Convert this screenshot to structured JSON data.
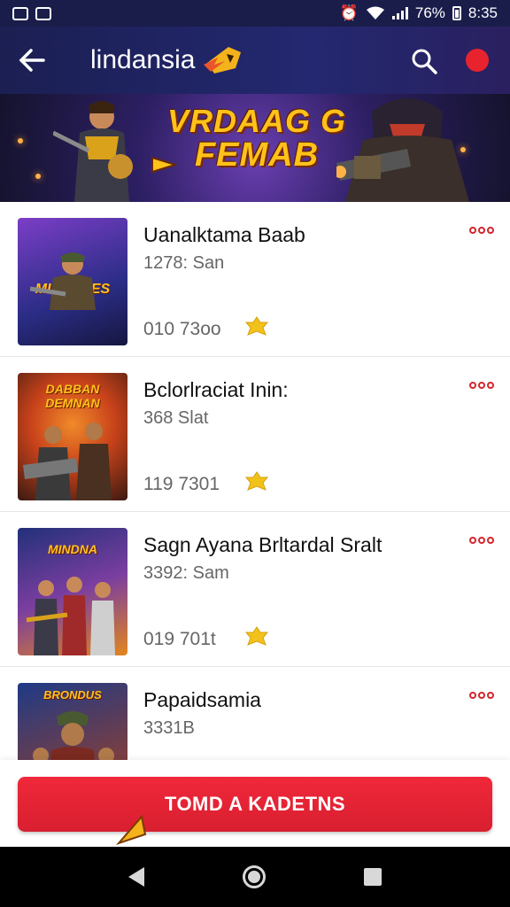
{
  "status_bar": {
    "battery": "76%",
    "time": "8:35",
    "icons": [
      "gallery-icon",
      "notification-icon",
      "alarm-icon",
      "wifi-icon",
      "signal-icon",
      "battery-icon"
    ]
  },
  "app_bar": {
    "title": "lindansia",
    "back_icon": "arrow-left-icon",
    "search_icon": "search-icon",
    "record_icon": "red-dot-icon"
  },
  "banner": {
    "line1": "VRDAAG G",
    "line2": "FEMAB"
  },
  "list": {
    "items": [
      {
        "thumb_title": "MIDNSCES GIAD",
        "title": "Uanalktama Baab",
        "subtitle": "1278: San",
        "count": "010 73oo",
        "colors": [
          "#2b2d86",
          "#7b3ec7"
        ]
      },
      {
        "thumb_title": "DABBAN DEMNAN",
        "title": "Bclorlraciat Inin:",
        "subtitle": "368 Slat",
        "count": "119 7301",
        "colors": [
          "#c8421a",
          "#3a1a12"
        ]
      },
      {
        "thumb_title": "MINDNA",
        "title": "Sagn Ayana Brltardal Sralt",
        "subtitle": "3392: Sam",
        "count": "019 701t",
        "colors": [
          "#22307a",
          "#e2861d"
        ]
      },
      {
        "thumb_title": "BRONDUS",
        "title": "Papaidsamia",
        "subtitle": "3331B",
        "count": "",
        "colors": [
          "#1f3a86",
          "#a8401f"
        ]
      }
    ]
  },
  "cta": {
    "label": "TOMD A KADETNS"
  },
  "colors": {
    "accent": "#e8232d",
    "header": "#1b1f52",
    "coin": "#f2c21b"
  }
}
